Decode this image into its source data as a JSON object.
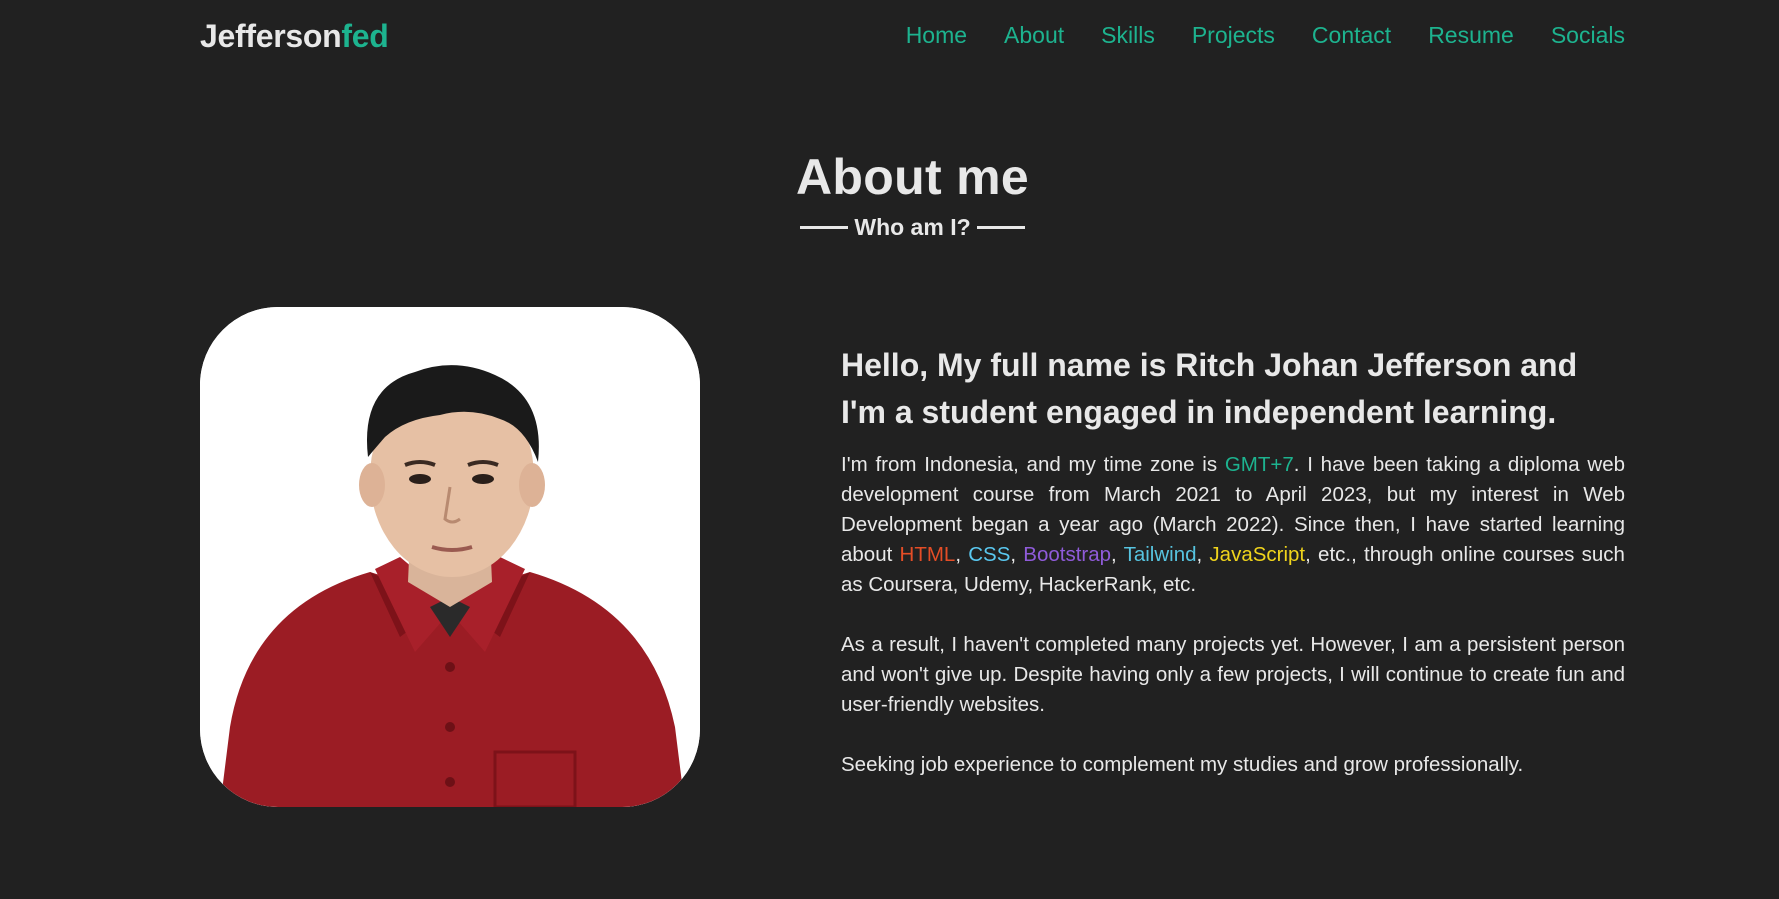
{
  "header": {
    "logo_main": "Jefferson",
    "logo_accent": "fed",
    "nav": [
      "Home",
      "About",
      "Skills",
      "Projects",
      "Contact",
      "Resume",
      "Socials"
    ]
  },
  "section": {
    "title": "About me",
    "subtitle": "Who am I?"
  },
  "about": {
    "heading": "Hello, My full name is Ritch Johan Jefferson and I'm a student engaged in independent learning.",
    "p1": {
      "intro": "I'm from Indonesia, and my time zone is ",
      "timezone": "GMT+7",
      "after_tz": ". I have been taking a diploma web development course from March 2021 to April 2023, but my interest in Web Development began a year ago (March 2022). Since then, I have started learning about ",
      "skill_html": "HTML",
      "sep1": ", ",
      "skill_css": "CSS",
      "sep2": ", ",
      "skill_bootstrap": "Bootstrap",
      "sep3": ", ",
      "skill_tailwind": "Tailwind",
      "sep4": ", ",
      "skill_js": "JavaScript",
      "outro": ", etc., through online courses such as Coursera, Udemy, HackerRank, etc."
    },
    "p2": "As a result, I haven't completed many projects yet. However, I am a persistent person and won't give up. Despite having only a few projects, I will continue to create fun and user-friendly websites.",
    "p3": "Seeking job experience to complement my studies and grow professionally."
  },
  "colors": {
    "background": "#212121",
    "accent": "#1db38f",
    "text": "#e8e8e8",
    "html": "#e44d26",
    "css": "#5ac8f0",
    "bootstrap": "#8f5bd9",
    "tailwind": "#57c4e0",
    "javascript": "#f0d41c"
  }
}
